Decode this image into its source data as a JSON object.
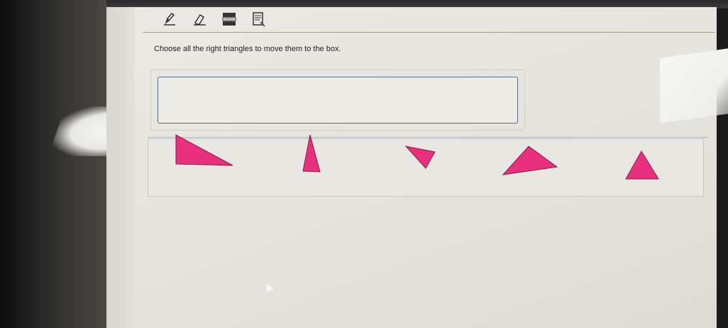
{
  "toolbar": {
    "tools": [
      {
        "name": "pencil-icon"
      },
      {
        "name": "eraser-icon"
      },
      {
        "name": "line-reader-icon"
      },
      {
        "name": "notepad-icon"
      }
    ]
  },
  "question": {
    "instruction": "Choose all the right triangles to move them to the box."
  },
  "colors": {
    "triangle_fill": "#e8307e",
    "triangle_stroke": "#8a1a48",
    "box_border": "#4f6f90"
  },
  "triangles": [
    {
      "id": "triangle-1"
    },
    {
      "id": "triangle-2"
    },
    {
      "id": "triangle-3"
    },
    {
      "id": "triangle-4"
    },
    {
      "id": "triangle-5"
    }
  ]
}
